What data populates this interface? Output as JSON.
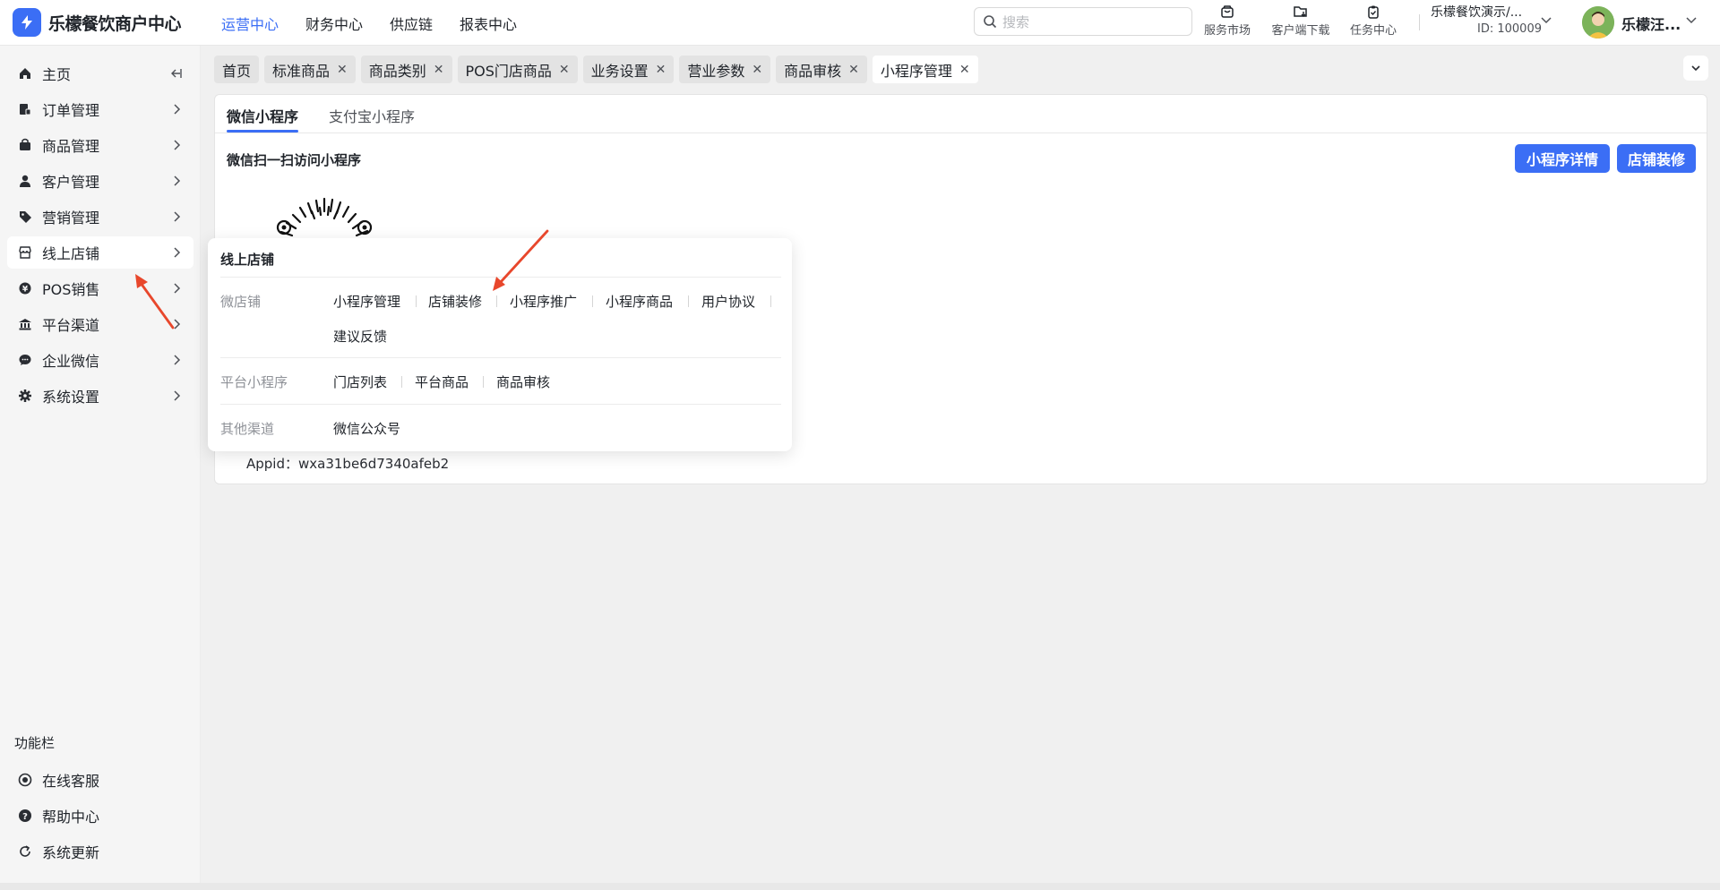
{
  "app": {
    "title": "乐檬餐饮商户中心",
    "accent": "#3b6ef5"
  },
  "topnav": [
    {
      "label": "运营中心",
      "active": true
    },
    {
      "label": "财务中心"
    },
    {
      "label": "供应链"
    },
    {
      "label": "报表中心"
    }
  ],
  "search": {
    "placeholder": "搜索"
  },
  "tools": [
    {
      "label": "服务市场",
      "icon": "shop-bag-icon"
    },
    {
      "label": "客户端下载",
      "icon": "folder-download-icon"
    },
    {
      "label": "任务中心",
      "icon": "clipboard-check-icon"
    }
  ],
  "shop": {
    "name": "乐檬餐饮演示/...",
    "id": "ID: 100009"
  },
  "user": {
    "name": "乐檬汪..."
  },
  "sidebar": {
    "items": [
      {
        "label": "主页",
        "icon": "home-icon"
      },
      {
        "label": "订单管理",
        "icon": "order-icon"
      },
      {
        "label": "商品管理",
        "icon": "goods-icon"
      },
      {
        "label": "客户管理",
        "icon": "user-icon"
      },
      {
        "label": "营销管理",
        "icon": "tag-icon"
      },
      {
        "label": "线上店铺",
        "icon": "store-icon",
        "active": true
      },
      {
        "label": "POS销售",
        "icon": "pos-icon"
      },
      {
        "label": "平台渠道",
        "icon": "bank-icon"
      },
      {
        "label": "企业微信",
        "icon": "wechat-icon"
      },
      {
        "label": "系统设置",
        "icon": "gear-icon"
      }
    ],
    "func_title": "功能栏",
    "func_items": [
      {
        "label": "在线客服",
        "icon": "headset-icon"
      },
      {
        "label": "帮助中心",
        "icon": "help-icon"
      },
      {
        "label": "系统更新",
        "icon": "refresh-icon"
      }
    ]
  },
  "tabs": [
    {
      "label": "首页",
      "closable": false
    },
    {
      "label": "标准商品",
      "closable": true
    },
    {
      "label": "商品类别",
      "closable": true
    },
    {
      "label": "POS门店商品",
      "closable": true
    },
    {
      "label": "业务设置",
      "closable": true
    },
    {
      "label": "营业参数",
      "closable": true
    },
    {
      "label": "商品审核",
      "closable": true
    },
    {
      "label": "小程序管理",
      "closable": true,
      "active": true
    }
  ],
  "tab_close_glyph": "✕",
  "content": {
    "subtabs": [
      {
        "label": "微信小程序",
        "active": true
      },
      {
        "label": "支付宝小程序"
      }
    ],
    "section_title": "微信扫一扫访问小程序",
    "buttons": {
      "detail": "小程序详情",
      "decorate": "店铺装修"
    },
    "appid_label": "Appid：",
    "appid_value": "wxa31be6d7340afeb2"
  },
  "flyout": {
    "title": "线上店铺",
    "groups": [
      {
        "name": "微店铺",
        "links": [
          "小程序管理",
          "店铺装修",
          "小程序推广",
          "小程序商品",
          "用户协议",
          "建议反馈"
        ]
      },
      {
        "name": "平台小程序",
        "links": [
          "门店列表",
          "平台商品",
          "商品审核"
        ]
      },
      {
        "name": "其他渠道",
        "links": [
          "微信公众号"
        ]
      }
    ]
  },
  "annotation_color": "#e8472c"
}
